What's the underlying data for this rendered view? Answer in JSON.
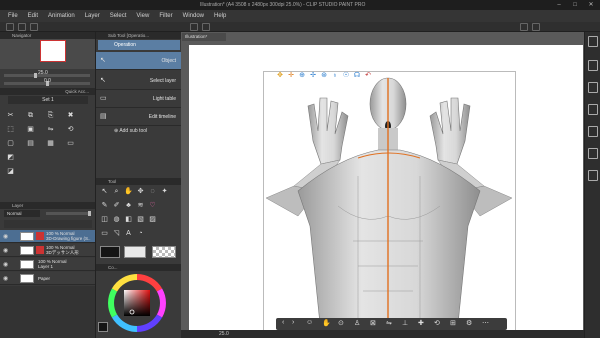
{
  "window": {
    "title": "Illustration* (A4 3508 x 2480px 300dpi 25.0%) - CLIP STUDIO PAINT PRO",
    "controls": [
      "–",
      "□",
      "✕"
    ]
  },
  "menu": [
    "File",
    "Edit",
    "Animation",
    "Layer",
    "Select",
    "View",
    "Filter",
    "Window",
    "Help"
  ],
  "navigator": {
    "title": "Navigator",
    "zoom": "25.0",
    "rotation": "0.0"
  },
  "sub_tool_panel": {
    "title": "Sub Tool [Operatio..."
  },
  "sub_tool_group": {
    "label": "Operation"
  },
  "sub_tools": [
    {
      "label": "Object",
      "selected": true
    },
    {
      "label": "Select layer",
      "selected": false
    },
    {
      "label": "Light table",
      "selected": false
    },
    {
      "label": "Edit timeline",
      "selected": false
    }
  ],
  "add_sub_tool": "Add sub tool",
  "set_panel": {
    "tab": "Quick Acc...",
    "set_label": "Set 1"
  },
  "tool_panel": {
    "title": "Tool"
  },
  "layer_panel": {
    "title": "Layer",
    "blend_mode": "Normal",
    "opacity": "100",
    "layers": [
      {
        "line1": "100 % Normal",
        "line2": "3D-Drawing figure (S..",
        "selected": true
      },
      {
        "line1": "100 % Normal",
        "line2": "3Dデッサン人形",
        "selected": false
      },
      {
        "line1": "100 % Normal",
        "line2": "Layer 1",
        "selected": false
      },
      {
        "line1": "",
        "line2": "Paper",
        "selected": false
      }
    ]
  },
  "color_panel": {
    "tab": "Co...",
    "main_color": "#151515",
    "sub_color": "#ffffff"
  },
  "document_tab": "Illustration*",
  "status": {
    "zoom": "25.0"
  },
  "colors": {
    "selected_bg": "#4c6e92",
    "sub_selected_bg": "#5b7ea3",
    "accent_orange": "#e07020"
  }
}
